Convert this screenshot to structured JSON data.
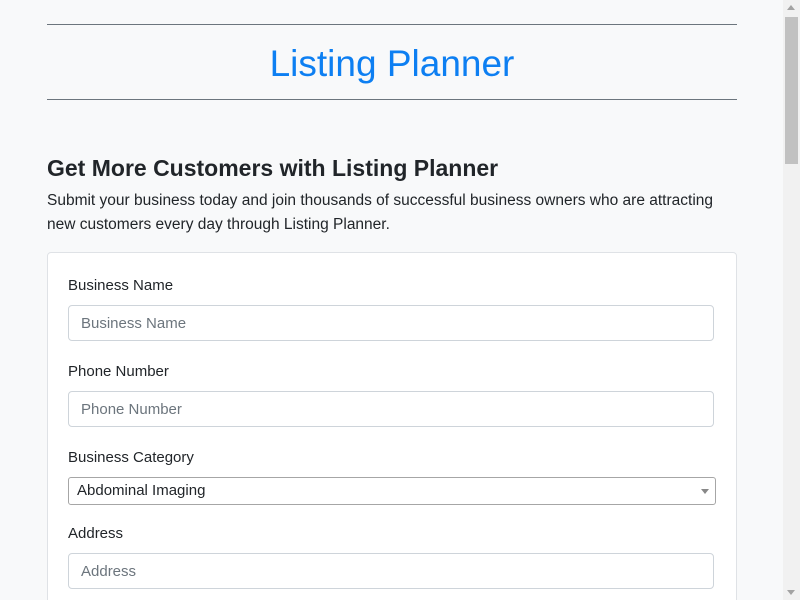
{
  "header": {
    "title": "Listing Planner"
  },
  "intro": {
    "heading": "Get More Customers with Listing Planner",
    "text": "Submit your business today and join thousands of successful business owners who are attracting new customers every day through Listing Planner."
  },
  "form": {
    "business_name": {
      "label": "Business Name",
      "placeholder": "Business Name",
      "value": ""
    },
    "phone_number": {
      "label": "Phone Number",
      "placeholder": "Phone Number",
      "value": ""
    },
    "business_category": {
      "label": "Business Category",
      "selected": "Abdominal Imaging"
    },
    "address": {
      "label": "Address",
      "placeholder": "Address",
      "value": ""
    }
  },
  "colors": {
    "accent": "#0d7ff2",
    "background": "#f8f9fa",
    "text": "#212529"
  }
}
